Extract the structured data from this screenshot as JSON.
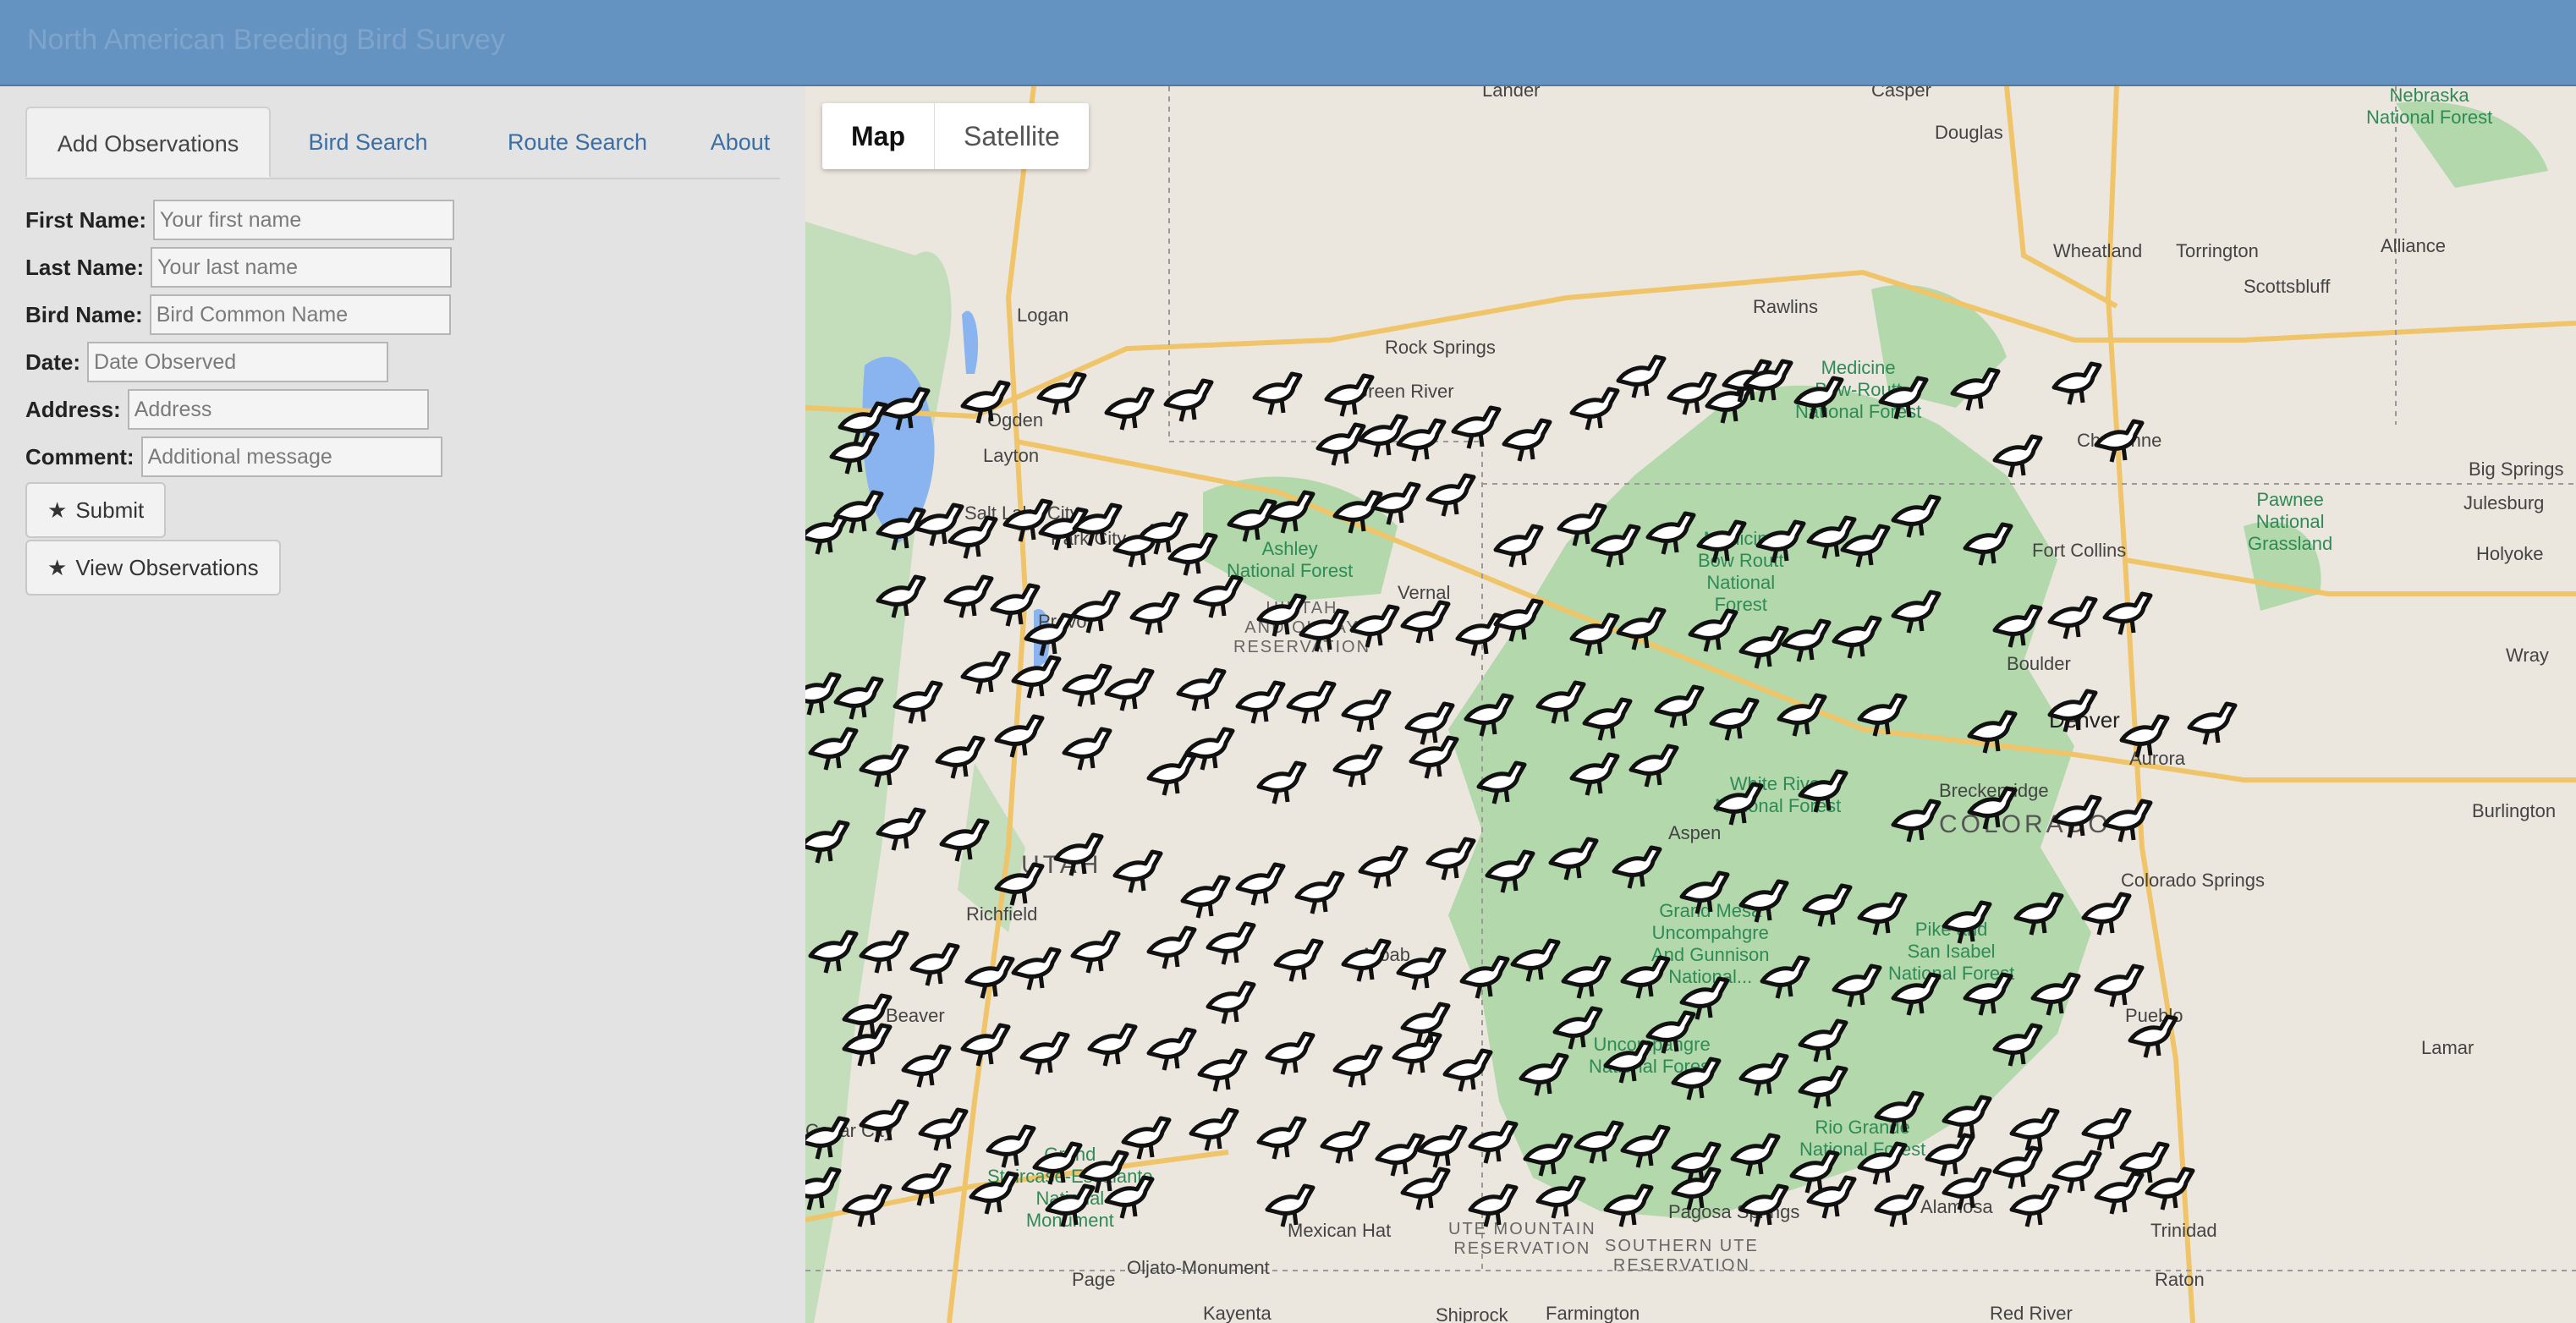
{
  "app": {
    "title": "North American Breeding Bird Survey"
  },
  "tabs": [
    {
      "label": "Add Observations",
      "active": true
    },
    {
      "label": "Bird Search",
      "active": false
    },
    {
      "label": "Route Search",
      "active": false
    },
    {
      "label": "About",
      "active": false
    }
  ],
  "form": {
    "first_name": {
      "label": "First Name:",
      "placeholder": "Your first name"
    },
    "last_name": {
      "label": "Last Name:",
      "placeholder": "Your last name"
    },
    "bird_name": {
      "label": "Bird Name:",
      "placeholder": "Bird Common Name"
    },
    "date": {
      "label": "Date:",
      "placeholder": "Date Observed"
    },
    "address": {
      "label": "Address:",
      "placeholder": "Address"
    },
    "comment": {
      "label": "Comment:",
      "placeholder": "Additional message"
    }
  },
  "buttons": {
    "submit": "Submit",
    "view": "View Observations",
    "star_icon": "star-icon"
  },
  "map": {
    "type_control": {
      "map": "Map",
      "satellite": "Satellite",
      "selected": "Map"
    },
    "marker_icon": "bird-icon",
    "places": {
      "douglas": "Douglas",
      "wheatland": "Wheatland",
      "torrington": "Torrington",
      "alliance": "Alliance",
      "scottsbluff": "Scottsbluff",
      "rawlins": "Rawlins",
      "rock_springs": "Rock Springs",
      "green_river": "Green River",
      "logan": "Logan",
      "ogden": "Ogden",
      "layton": "Layton",
      "salt_lake_city": "Salt Lake City",
      "park_city": "Park City",
      "provo": "Provo",
      "vernal": "Vernal",
      "cheyenne": "Cheyenne",
      "fort_collins": "Fort Collins",
      "big_springs": "Big Springs",
      "julesburg": "Julesburg",
      "holyoke": "Holyoke",
      "wray": "Wray",
      "boulder": "Boulder",
      "denver": "Denver",
      "aurora": "Aurora",
      "breckenridge": "Breckenridge",
      "colorado_springs": "Colorado Springs",
      "pueblo": "Pueblo",
      "lamar": "Lamar",
      "trinidad": "Trinidad",
      "raton": "Raton",
      "alamosa": "Alamosa",
      "richfield": "Richfield",
      "beaver": "Beaver",
      "cedar_city": "Cedar City",
      "moab": "Moab",
      "mexican_hat": "Mexican Hat",
      "page": "Page",
      "oljato": "Oljato-Monument",
      "kayenta": "Kayenta",
      "farmington": "Farmington",
      "shiprock": "Shiprock",
      "red_river": "Red River",
      "pagosa_springs": "Pagosa Springs",
      "aspen": "Aspen",
      "burlington": "Burlington",
      "lander": "Lander",
      "casper": "Casper"
    },
    "regions": {
      "utah": "UTAH",
      "colorado": "COLORADO",
      "uintah": "UINTAH\nAND OURAY\nRESERVATION",
      "ute_mountain": "UTE MOUNTAIN\nRESERVATION",
      "southern_ute": "SOUTHERN UTE\nRESERVATION"
    },
    "forests": {
      "medicine_bow_wy": "Medicine\nBow-Routt\nNational Forest",
      "medicine_bow_co": "Medicine\nBow Routt\nNational\nForest",
      "ashley": "Ashley\nNational Forest",
      "white_river": "White River\nNational Forest",
      "gmug": "Grand Mesa\nUncompahgre\nAnd Gunnison\nNational...",
      "pike": "Pike and\nSan Isabel\nNational Forest",
      "rio_grande": "Rio Grande\nNational Forest",
      "uncompahgre": "Uncompahgre\nNational Forest",
      "nebraska": "Nebraska\nNational Forest",
      "pawnee": "Pawnee\nNational\nGrassland",
      "grand_staircase": "Grand\nStaircase-Escalante\nNational\nMonument"
    }
  }
}
